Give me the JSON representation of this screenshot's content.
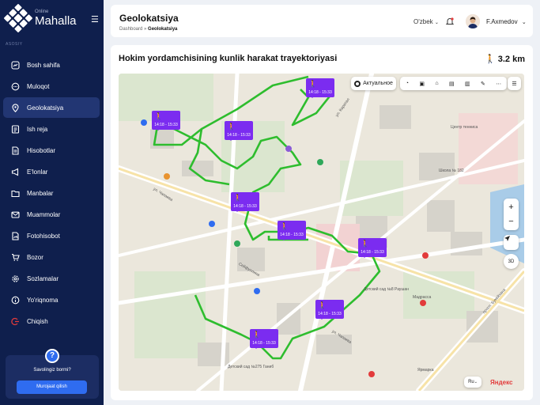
{
  "brand": {
    "small": "Online",
    "big": "Mahalla"
  },
  "sidebar": {
    "section_label": "ASOSIY",
    "items": [
      {
        "label": "Bosh sahifa",
        "icon": "dashboard-icon",
        "active": false
      },
      {
        "label": "Muloqot",
        "icon": "chat-icon",
        "active": false
      },
      {
        "label": "Geolokatsiya",
        "icon": "location-pin-icon",
        "active": true
      },
      {
        "label": "Ish reja",
        "icon": "plan-icon",
        "active": false
      },
      {
        "label": "Hisobotlar",
        "icon": "report-icon",
        "active": false
      },
      {
        "label": "E'lonlar",
        "icon": "megaphone-icon",
        "active": false
      },
      {
        "label": "Manbalar",
        "icon": "folder-icon",
        "active": false
      },
      {
        "label": "Muammolar",
        "icon": "mail-icon",
        "active": false
      },
      {
        "label": "Fotohisobot",
        "icon": "photo-report-icon",
        "active": false
      },
      {
        "label": "Bozor",
        "icon": "cart-icon",
        "active": false
      },
      {
        "label": "Sozlamalar",
        "icon": "gear-icon",
        "active": false
      },
      {
        "label": "Yo'riqnoma",
        "icon": "info-icon",
        "active": false
      },
      {
        "label": "Chiqish",
        "icon": "logout-icon",
        "active": false
      }
    ],
    "help": {
      "title": "Savolingiz bormi?",
      "button": "Murojaat qilish",
      "icon": "?"
    }
  },
  "header": {
    "title": "Geolokatsiya",
    "breadcrumb_root": "Dashboard",
    "breadcrumb_sep": " » ",
    "breadcrumb_current": "Geolokatsiya",
    "language": "O'zbek",
    "user_name": "F.Axmedov"
  },
  "card": {
    "title": "Hokim yordamchisining kunlik harakat trayektoriyasi",
    "distance": "3.2 km"
  },
  "map": {
    "layer_label": "Актуальное",
    "zoom_in": "+",
    "zoom_out": "−",
    "view_3d": "3D",
    "lang": "Ru",
    "provider": "Яндекс",
    "route_color": "#2ebd2e",
    "marker_color": "#7b2cf0",
    "markers": [
      {
        "time": "14:18 - 15:33"
      },
      {
        "time": "14:18 - 15:33"
      },
      {
        "time": "14:18 - 15:33"
      },
      {
        "time": "14:18 - 15:33"
      },
      {
        "time": "14:18 - 15:33"
      },
      {
        "time": "14:18 - 15:33"
      },
      {
        "time": "14:18 - 15:33"
      },
      {
        "time": "14:18 - 15:33"
      }
    ],
    "labels": {
      "street1": "ул. Чапаева",
      "street2": "ул. Чапаева",
      "street3": "ул. Каратал",
      "street4": "Сейфуллина",
      "street5": "просп. Букейхана",
      "place1": "Детский сад №8 Раушан",
      "place2": "Школа № 182",
      "place3": "Центр тенниса",
      "place4": "Мадрасса",
      "place5": "Детский сад №275 Ганиб",
      "place6": "Ярмарка"
    }
  }
}
